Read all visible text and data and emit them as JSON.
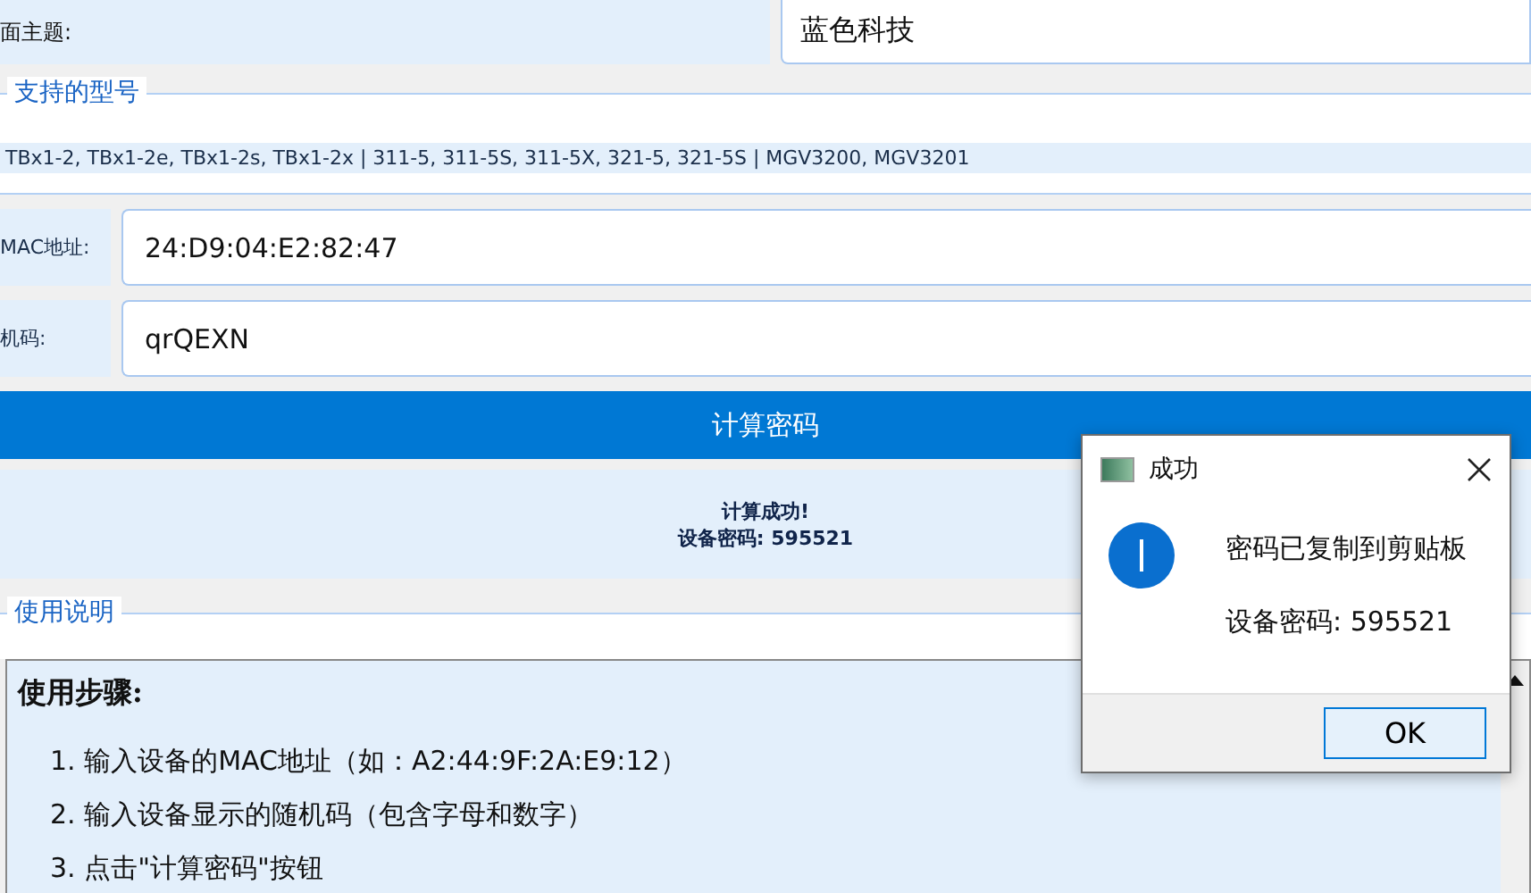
{
  "theme_row": {
    "label": "面主题:",
    "value": "蓝色科技"
  },
  "models_group": {
    "title": "支持的型号",
    "models": "TBx1-2, TBx1-2e, TBx1-2s, TBx1-2x | 311-5, 311-5S, 311-5X, 321-5, 321-5S | MGV3200, MGV3201"
  },
  "fields": [
    {
      "label": "MAC地址:",
      "value": "24:D9:04:E2:82:47"
    },
    {
      "label": "机码:",
      "value": "qrQEXN"
    }
  ],
  "calc_button": "计算密码",
  "result": [
    "计算成功!",
    "设备密码: 595521"
  ],
  "help_group": {
    "title": "使用说明",
    "heading": "使用步骤:",
    "steps": [
      "1. 输入设备的MAC地址（如：A2:44:9F:2A:E9:12）",
      "2. 输入设备显示的随机码（包含字母和数字）",
      "3. 点击\"计算密码\"按钮"
    ]
  },
  "dialog": {
    "title": "成功",
    "message": "密码已复制到剪贴板",
    "detail": "设备密码: 595521",
    "button": "OK"
  }
}
